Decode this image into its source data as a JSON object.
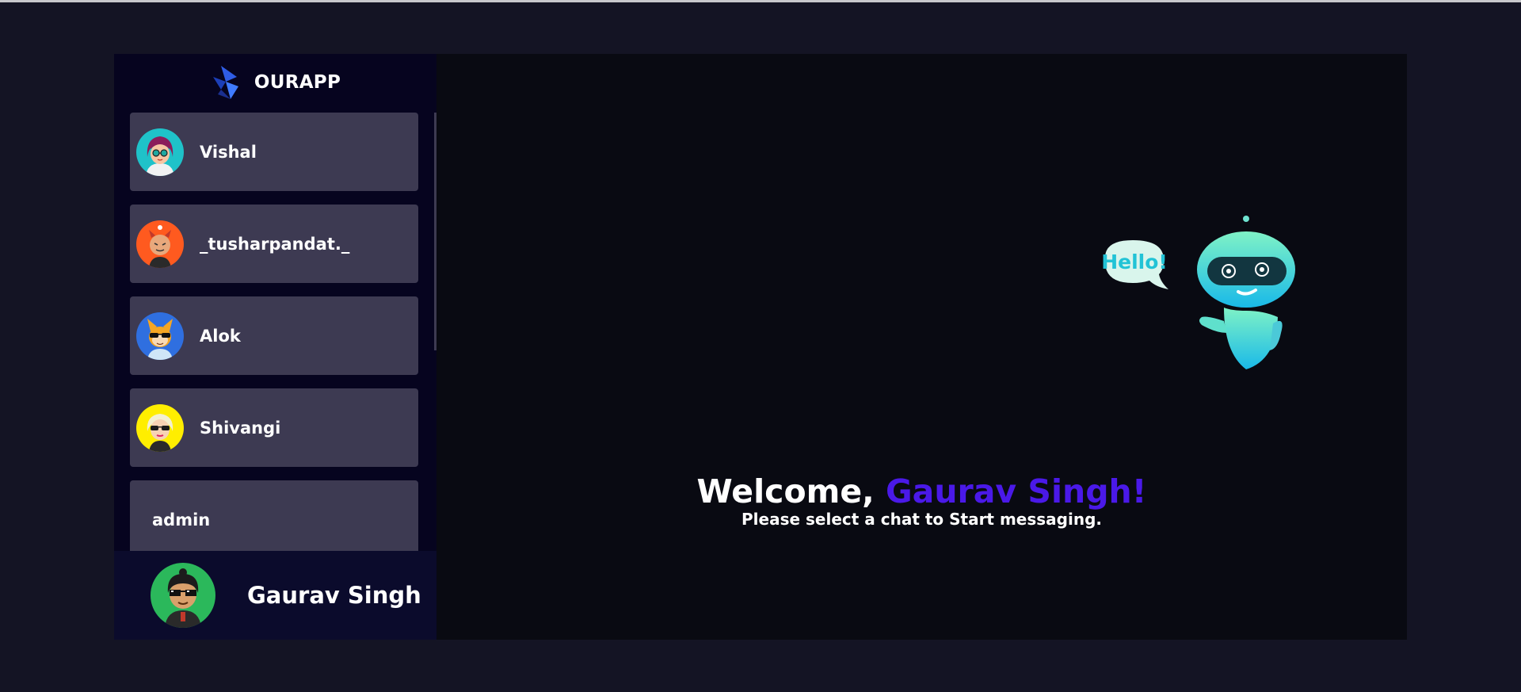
{
  "app": {
    "brand_name": "OURAPP"
  },
  "sidebar": {
    "contacts": [
      {
        "name": "Vishal",
        "avatar": "girl-glasses-avatar",
        "avatar_bg": "#1fc2c9"
      },
      {
        "name": "_tusharpandat._",
        "avatar": "devil-avatar",
        "avatar_bg": "#ff5a1f"
      },
      {
        "name": "Alok",
        "avatar": "fox-sunglasses-avatar",
        "avatar_bg": "#2f6fe0"
      },
      {
        "name": "Shivangi",
        "avatar": "blonde-sunglasses-avatar",
        "avatar_bg": "#ffee00"
      },
      {
        "name": "admin",
        "avatar": null
      }
    ]
  },
  "current_user": {
    "name": "Gaurav Singh",
    "avatar": "pixel-glasses-avatar",
    "avatar_bg": "#2bb85b"
  },
  "welcome": {
    "prefix": "Welcome, ",
    "user_name": "Gaurav Singh!",
    "subtitle": "Please select a chat to Start messaging.",
    "illustration": "hello-robot-illustration",
    "bubble_text": "Hello!"
  },
  "colors": {
    "page_bg": "#141424",
    "sidebar_bg": "#06041f",
    "contact_card_bg": "#3d3a52",
    "main_bg": "#090a12",
    "accent_purple": "#4a19e8"
  }
}
